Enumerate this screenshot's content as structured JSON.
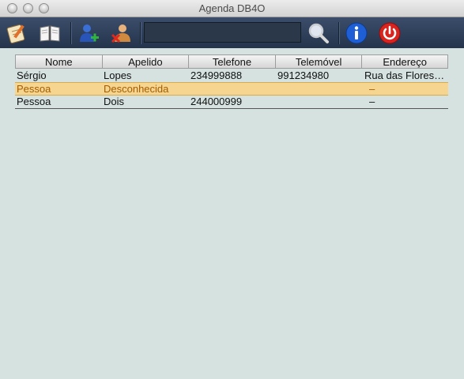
{
  "window": {
    "title": "Agenda DB4O"
  },
  "toolbar": {
    "icons": [
      "notes-icon",
      "address-book-icon",
      "add-contact-icon",
      "delete-contact-icon",
      "search-icon",
      "info-icon",
      "power-icon"
    ],
    "search": {
      "value": "",
      "placeholder": ""
    }
  },
  "table": {
    "columns": [
      "Nome",
      "Apelido",
      "Telefone",
      "Telemóvel",
      "Endereço"
    ],
    "rows": [
      {
        "nome": "Sérgio",
        "apelido": "Lopes",
        "telefone": "234999888",
        "telemovel": "991234980",
        "endereco": "Rua das Flores…"
      },
      {
        "nome": "Pessoa",
        "apelido": "Desconhecida",
        "telefone": "",
        "telemovel": "",
        "endereco": "–"
      },
      {
        "nome": "Pessoa",
        "apelido": "Dois",
        "telefone": "244000999",
        "telemovel": "",
        "endereco": "–"
      }
    ],
    "selected_row": 1
  },
  "colors": {
    "toolbar": "#2f3f58",
    "background": "#d5e2e0",
    "selection": "#f6d590",
    "selection_text": "#a35d00"
  }
}
